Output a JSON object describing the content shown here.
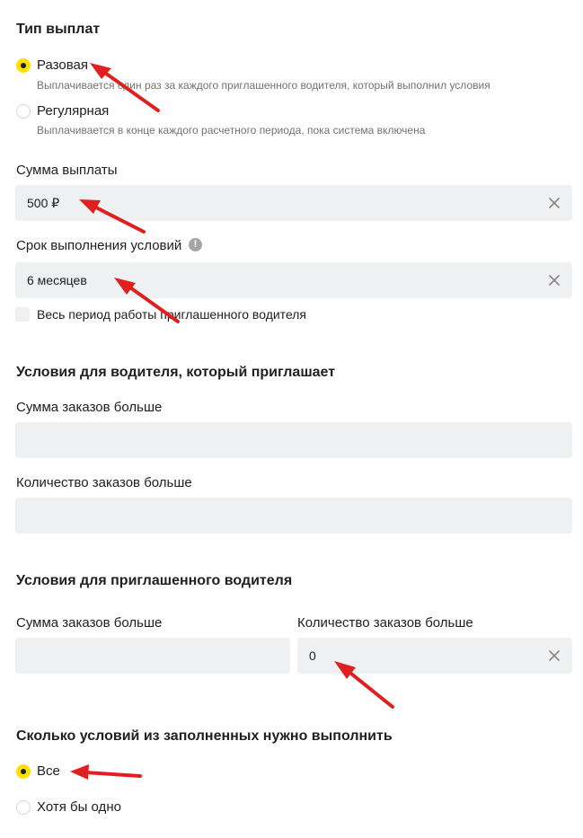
{
  "payout_type": {
    "title": "Тип выплат",
    "options": [
      {
        "label": "Разовая",
        "hint": "Выплачивается один раз за каждого приглашенного водителя, который выполнил условия",
        "selected": true
      },
      {
        "label": "Регулярная",
        "hint": "Выплачивается в конце каждого расчетного периода, пока система включена",
        "selected": false
      }
    ]
  },
  "payout_amount": {
    "label": "Сумма выплаты",
    "value": "500 ₽"
  },
  "term": {
    "label": "Срок выполнения условий",
    "info_icon": "!",
    "value": "6 месяцев",
    "checkbox_label": "Весь период работы приглашенного водителя"
  },
  "inviter_conditions": {
    "title": "Условия для водителя, который приглашает",
    "orders_sum_label": "Сумма заказов больше",
    "orders_sum_value": "",
    "orders_count_label": "Количество заказов больше",
    "orders_count_value": ""
  },
  "invitee_conditions": {
    "title": "Условия для приглашенного водителя",
    "orders_sum_label": "Сумма заказов больше",
    "orders_sum_value": "",
    "orders_count_label": "Количество заказов больше",
    "orders_count_value": "0"
  },
  "conditions_required": {
    "title": "Сколько условий из заполненных нужно выполнить",
    "options": [
      {
        "label": "Все",
        "selected": true
      },
      {
        "label": "Хотя бы одно",
        "selected": false
      }
    ]
  },
  "colors": {
    "accent": "#fce000",
    "field_bg": "#eef0f2",
    "annotation": "#e02020"
  }
}
